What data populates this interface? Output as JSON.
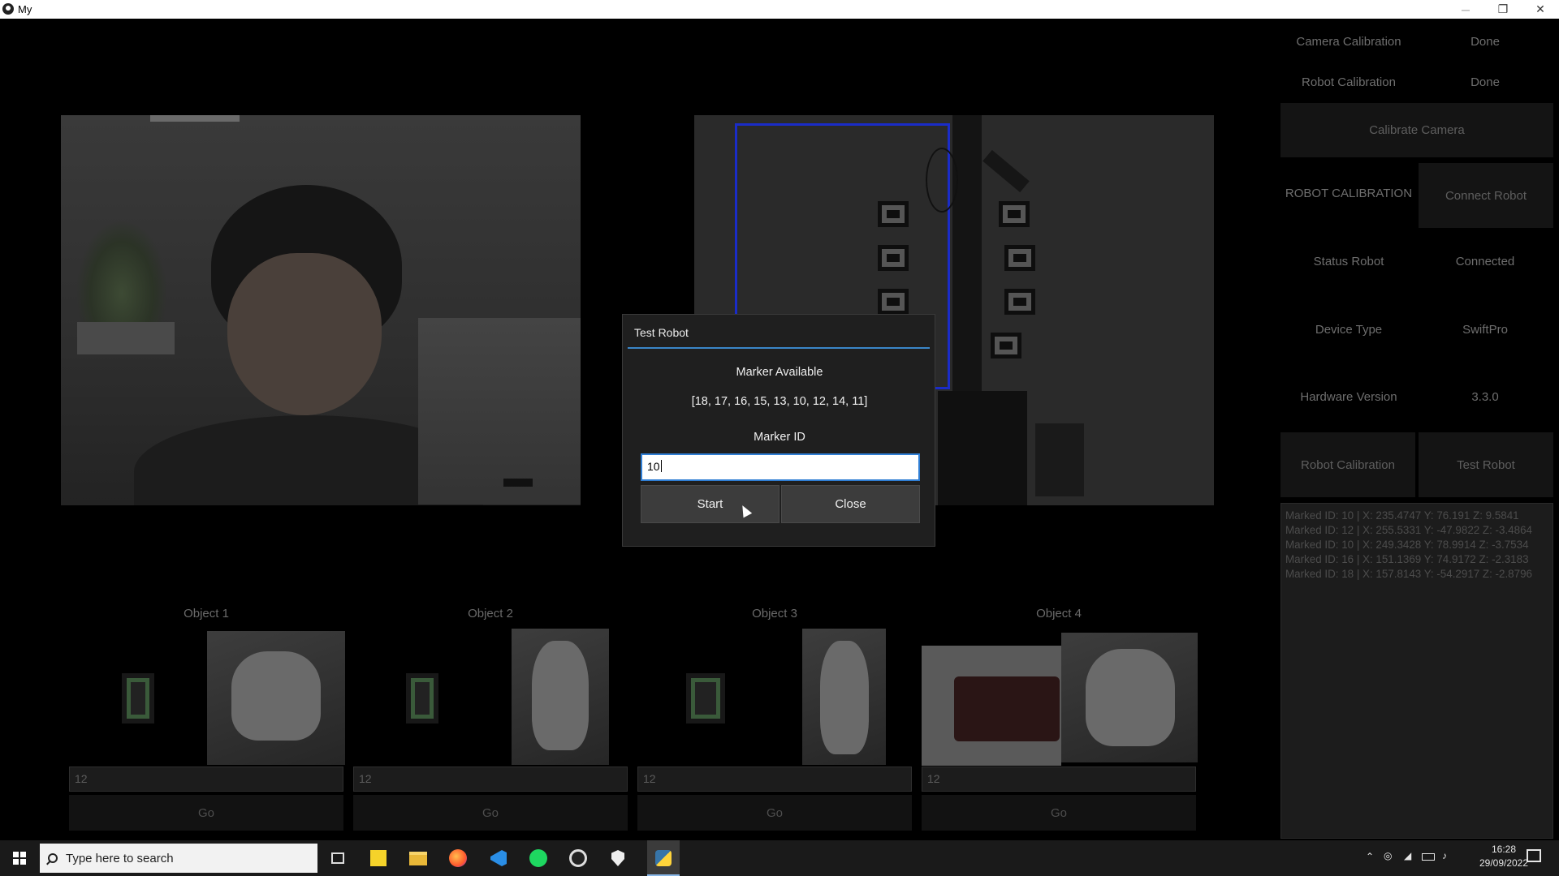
{
  "window": {
    "title": "My",
    "minimize": "─",
    "maximize": "❐",
    "close": "✕"
  },
  "panel": {
    "camera_calibration_label": "Camera Calibration",
    "camera_calibration_status": "Done",
    "robot_calibration_label": "Robot Calibration",
    "robot_calibration_status": "Done",
    "calibrate_camera_button": "Calibrate Camera",
    "robot_calibration_header": "ROBOT CALIBRATION",
    "connect_robot_button": "Connect Robot",
    "status_robot_label": "Status Robot",
    "status_robot_value": "Connected",
    "device_type_label": "Device Type",
    "device_type_value": "SwiftPro",
    "hardware_version_label": "Hardware Version",
    "hardware_version_value": "3.3.0",
    "robot_calibration_button": "Robot Calibration",
    "test_robot_button": "Test Robot",
    "log_lines": [
      "Marked ID: 10 | X: 235.4747 Y: 76.191 Z: 9.5841",
      "Marked ID: 12 | X: 255.5331 Y: -47.9822 Z: -3.4864",
      "Marked ID: 10 | X: 249.3428 Y: 78.9914 Z: -3.7534",
      "Marked ID: 16 | X: 151.1369 Y: 74.9172 Z: -2.3183",
      "Marked ID: 18 | X: 157.8143 Y: -54.2917 Z: -2.8796"
    ]
  },
  "objects": [
    {
      "label": "Object 1",
      "value": "12",
      "go": "Go"
    },
    {
      "label": "Object 2",
      "value": "12",
      "go": "Go"
    },
    {
      "label": "Object 3",
      "value": "12",
      "go": "Go"
    },
    {
      "label": "Object 4",
      "value": "12",
      "go": "Go"
    }
  ],
  "dialog": {
    "title": "Test Robot",
    "marker_available_label": "Marker Available",
    "marker_list": "[18, 17, 16, 15, 13, 10, 12, 14, 11]",
    "marker_id_label": "Marker ID",
    "marker_id_value": "10",
    "start_button": "Start",
    "close_button": "Close"
  },
  "taskbar": {
    "search_placeholder": "Type here to search",
    "time": "16:28",
    "date": "29/09/2022"
  },
  "colors": {
    "accent": "#3a86c8",
    "roi_box": "#1a2cc8"
  }
}
